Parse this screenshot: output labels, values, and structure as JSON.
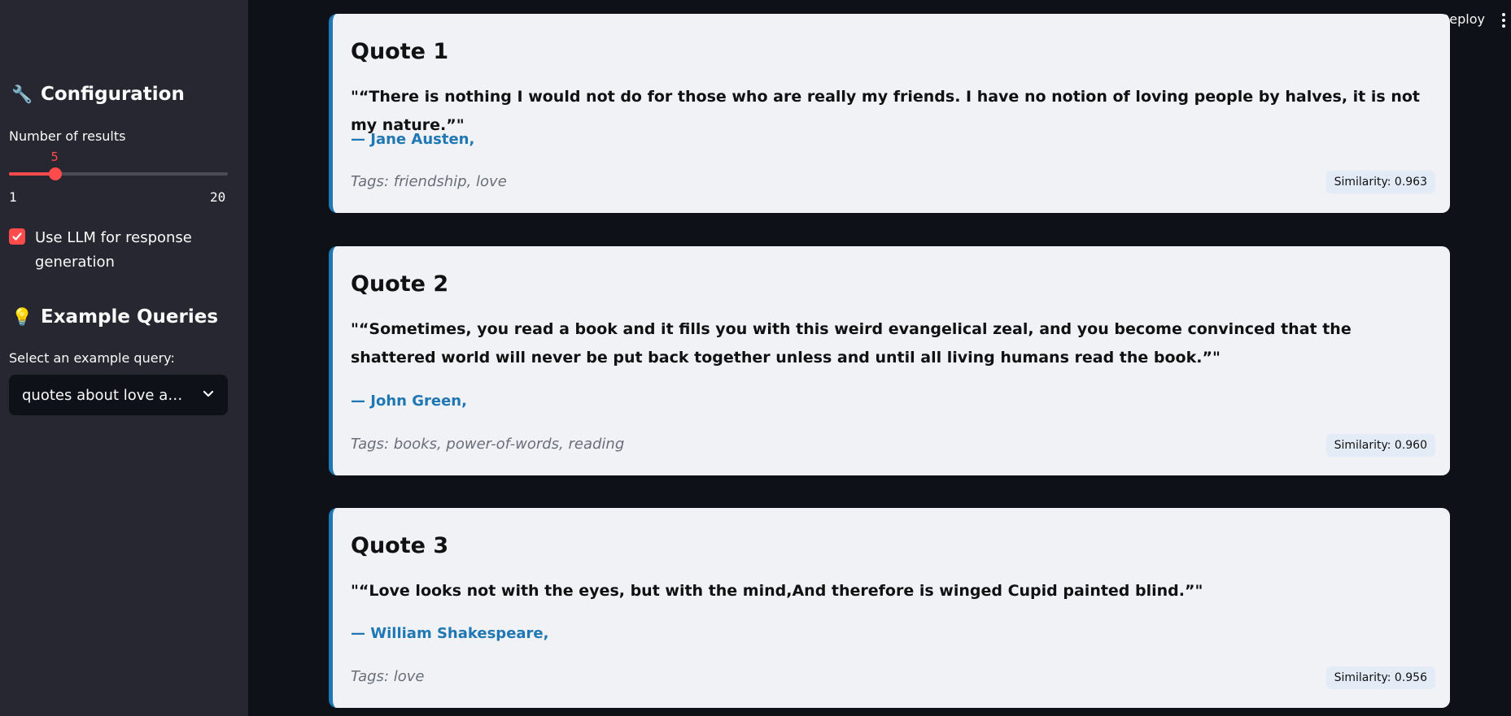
{
  "sidebar": {
    "config_title": "Configuration",
    "config_icon": "wrench-icon",
    "slider_label": "Number of results",
    "slider_value": "5",
    "slider_min": "1",
    "slider_max": "20",
    "slider_fraction": 0.2105,
    "llm_checkbox_label": "Use LLM for response generation",
    "llm_checked": true,
    "examples_title": "Example Queries",
    "examples_icon": "lightbulb-icon",
    "select_label": "Select an example query:",
    "select_value": "quotes about love an…"
  },
  "header": {
    "deploy_label": "Deploy"
  },
  "results": [
    {
      "title": "Quote 1",
      "quote": "\"“There is nothing I would not do for those who are really my friends. I have no notion of loving people by halves, it is not my nature.”\"",
      "author": "— Jane Austen,",
      "tags": "Tags: friendship, love",
      "similarity": "Similarity: 0.963"
    },
    {
      "title": "Quote 2",
      "quote": "\"“Sometimes, you read a book and it fills you with this weird evangelical zeal, and you become convinced that the shattered world will never be put back together unless and until all living humans read the book.”\"",
      "author": "— John Green,",
      "tags": "Tags: books, power-of-words, reading",
      "similarity": "Similarity: 0.960"
    },
    {
      "title": "Quote 3",
      "quote": "\"“Love looks not with the eyes, but with the mind,And therefore is winged Cupid painted blind.”\"",
      "author": "— William Shakespeare,",
      "tags": "Tags: love",
      "similarity": "Similarity: 0.956"
    }
  ],
  "colors": {
    "accent": "#ff4b4b",
    "author": "#1f77b4",
    "sidebar_bg": "#262730",
    "main_bg": "#0e1117",
    "card_bg": "#f0f2f6"
  }
}
